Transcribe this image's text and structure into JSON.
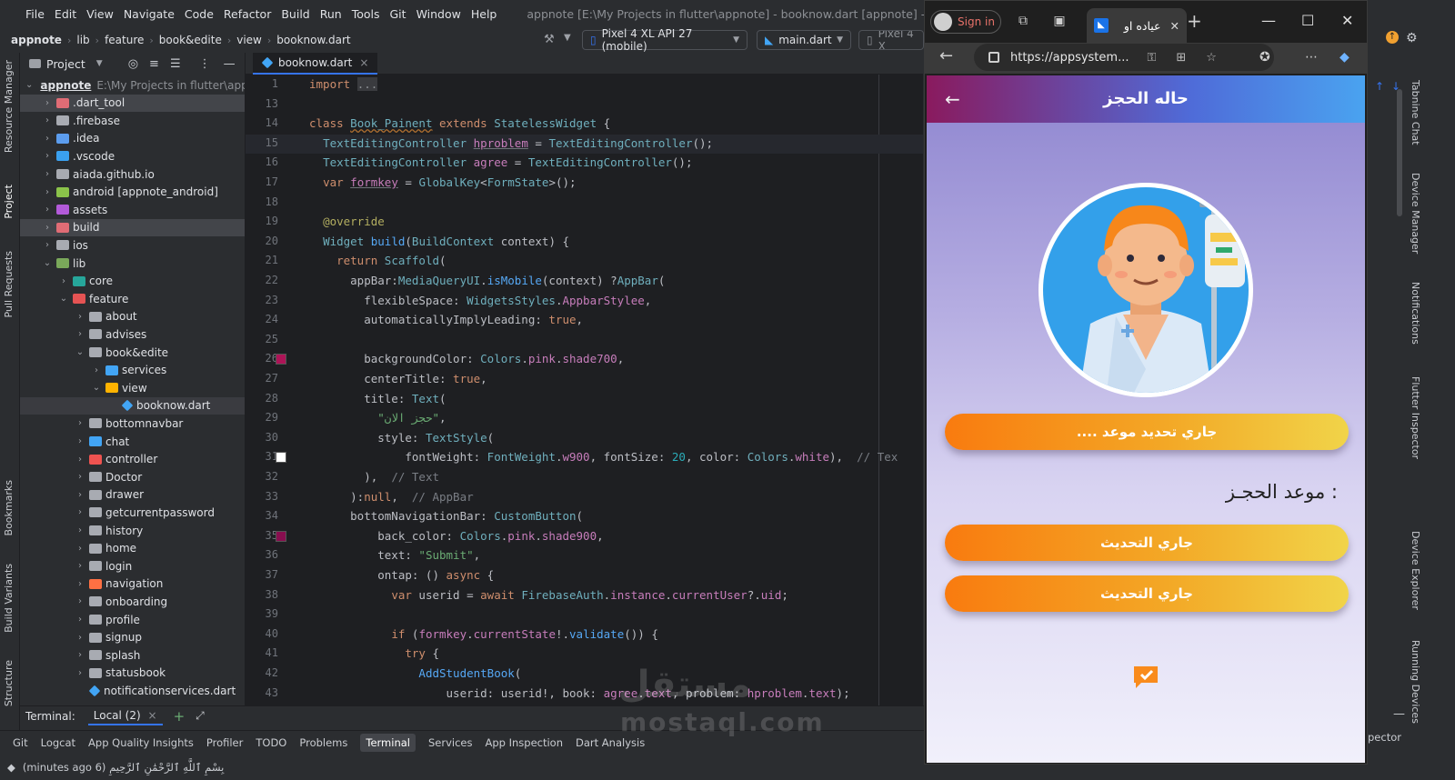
{
  "ide": {
    "menu": [
      "File",
      "Edit",
      "View",
      "Navigate",
      "Code",
      "Refactor",
      "Build",
      "Run",
      "Tools",
      "Git",
      "Window",
      "Help"
    ],
    "window_title": "appnote [E:\\My Projects in flutter\\appnote] - booknow.dart [appnote] - Administrator",
    "breadcrumbs": [
      "appnote",
      "lib",
      "feature",
      "book&edite",
      "view",
      "booknow.dart"
    ],
    "device": "Pixel 4 XL API 27 (mobile)",
    "run_config": "main.dart",
    "device2": "Pixel 4 X",
    "left_tabs": [
      "Resource Manager",
      "Project",
      "Pull Requests",
      "Bookmarks",
      "Build Variants",
      "Structure"
    ],
    "right_tabs": [
      "Tabnine Chat",
      "Device Manager",
      "Notifications",
      "Flutter Inspector",
      "Device Explorer",
      "Running Devices"
    ],
    "project_panel": {
      "title": "Project",
      "tree": [
        {
          "label": "appnote",
          "hint": "E:\\My Projects in flutter\\appno",
          "depth": 0,
          "open": true,
          "icon": "module",
          "bold": true
        },
        {
          "label": ".dart_tool",
          "depth": 1,
          "open": false,
          "icon": "folder-excluded",
          "selected": true
        },
        {
          "label": ".firebase",
          "depth": 1,
          "open": false,
          "icon": "folder"
        },
        {
          "label": ".idea",
          "depth": 1,
          "open": false,
          "icon": "folder-idea"
        },
        {
          "label": ".vscode",
          "depth": 1,
          "open": false,
          "icon": "folder-vscode"
        },
        {
          "label": "aiada.github.io",
          "depth": 1,
          "open": false,
          "icon": "folder"
        },
        {
          "label": "android [appnote_android]",
          "depth": 1,
          "open": false,
          "icon": "folder-android",
          "bold_part": "[appnote_android]"
        },
        {
          "label": "assets",
          "depth": 1,
          "open": false,
          "icon": "folder-assets"
        },
        {
          "label": "build",
          "depth": 1,
          "open": false,
          "icon": "folder-excluded",
          "selected": true
        },
        {
          "label": "ios",
          "depth": 1,
          "open": false,
          "icon": "folder"
        },
        {
          "label": "lib",
          "depth": 1,
          "open": true,
          "icon": "folder-source"
        },
        {
          "label": "core",
          "depth": 2,
          "open": false,
          "icon": "folder-core"
        },
        {
          "label": "feature",
          "depth": 2,
          "open": true,
          "icon": "folder-feature"
        },
        {
          "label": "about",
          "depth": 3,
          "open": false,
          "icon": "folder"
        },
        {
          "label": "advises",
          "depth": 3,
          "open": false,
          "icon": "folder"
        },
        {
          "label": "book&edite",
          "depth": 3,
          "open": true,
          "icon": "folder"
        },
        {
          "label": "services",
          "depth": 4,
          "open": false,
          "icon": "folder-services"
        },
        {
          "label": "view",
          "depth": 4,
          "open": true,
          "icon": "folder-view"
        },
        {
          "label": "booknow.dart",
          "depth": 5,
          "icon": "dart",
          "file": true,
          "selected2": true
        },
        {
          "label": "bottomnavbar",
          "depth": 3,
          "open": false,
          "icon": "folder"
        },
        {
          "label": "chat",
          "depth": 3,
          "open": false,
          "icon": "folder-chat"
        },
        {
          "label": "controller",
          "depth": 3,
          "open": false,
          "icon": "folder-controller"
        },
        {
          "label": "Doctor",
          "depth": 3,
          "open": false,
          "icon": "folder"
        },
        {
          "label": "drawer",
          "depth": 3,
          "open": false,
          "icon": "folder"
        },
        {
          "label": "getcurrentpassword",
          "depth": 3,
          "open": false,
          "icon": "folder"
        },
        {
          "label": "history",
          "depth": 3,
          "open": false,
          "icon": "folder"
        },
        {
          "label": "home",
          "depth": 3,
          "open": false,
          "icon": "folder-home"
        },
        {
          "label": "login",
          "depth": 3,
          "open": false,
          "icon": "folder"
        },
        {
          "label": "navigation",
          "depth": 3,
          "open": false,
          "icon": "folder-navigation"
        },
        {
          "label": "onboarding",
          "depth": 3,
          "open": false,
          "icon": "folder"
        },
        {
          "label": "profile",
          "depth": 3,
          "open": false,
          "icon": "folder"
        },
        {
          "label": "signup",
          "depth": 3,
          "open": false,
          "icon": "folder"
        },
        {
          "label": "splash",
          "depth": 3,
          "open": false,
          "icon": "folder"
        },
        {
          "label": "statusbook",
          "depth": 3,
          "open": false,
          "icon": "folder"
        },
        {
          "label": "notificationservices.dart",
          "depth": 3,
          "icon": "dart",
          "file": true
        }
      ]
    },
    "editor_tab": "booknow.dart",
    "code_lines": [
      {
        "n": "1",
        "html": "<span class='kw'>import</span> <span style='background:#3a3b3f;color:#8c8f94'>...</span>"
      },
      {
        "n": "13",
        "html": ""
      },
      {
        "n": "14",
        "html": "<span class='kw'>class</span> <span class='typ' style='text-decoration:underline wavy #b07030'>Book_Painent</span> <span class='kw'>extends</span> <span class='typ'>StatelessWidget</span> {"
      },
      {
        "n": "15",
        "html": "  <span class='typ'>TextEditingController</span> <span class='fld' style='text-decoration:underline #6f737a'>hproblem</span> = <span class='typ'>TextEditingController</span>();",
        "current": true
      },
      {
        "n": "16",
        "html": "  <span class='typ'>TextEditingController</span> <span class='fld'>agree</span> = <span class='typ'>TextEditingController</span>();"
      },
      {
        "n": "17",
        "html": "  <span class='kw'>var</span> <span class='fld' style='text-decoration:underline #6f737a'>formkey</span> = <span class='typ'>GlobalKey</span>&lt;<span class='typ'>FormState</span>&gt;();"
      },
      {
        "n": "18",
        "html": ""
      },
      {
        "n": "19",
        "html": "  <span class='ann'>@override</span>"
      },
      {
        "n": "20",
        "html": "  <span class='typ'>Widget</span> <span class='fn'>build</span>(<span class='typ'>BuildContext</span> context) {"
      },
      {
        "n": "21",
        "html": "    <span class='kw'>return</span> <span class='typ'>Scaffold</span>("
      },
      {
        "n": "22",
        "html": "      appBar:<span class='typ'>MediaQueryUI</span>.<span class='fn'>isMobile</span>(context) ?<span class='typ'>AppBar</span>("
      },
      {
        "n": "23",
        "html": "        flexibleSpace: <span class='typ'>WidgetsStyles</span>.<span class='fld'>AppbarStylee</span>,"
      },
      {
        "n": "24",
        "html": "        automaticallyImplyLeading: <span class='kw'>true</span>,"
      },
      {
        "n": "25",
        "html": ""
      },
      {
        "n": "26",
        "html": "        backgroundColor: <span class='typ'>Colors</span>.<span class='fld'>pink</span>.<span class='fld'>shade700</span>,",
        "swatch": "#ad1457"
      },
      {
        "n": "27",
        "html": "        centerTitle: <span class='kw'>true</span>,"
      },
      {
        "n": "28",
        "html": "        title: <span class='typ'>Text</span>("
      },
      {
        "n": "29",
        "html": "          <span class='str'>\"حجز الان\"</span>,"
      },
      {
        "n": "30",
        "html": "          style: <span class='typ'>TextStyle</span>("
      },
      {
        "n": "31",
        "html": "              fontWeight: <span class='typ'>FontWeight</span>.<span class='fld'>w900</span>, fontSize: <span class='num'>20</span>, color: <span class='typ'>Colors</span>.<span class='fld'>white</span>),  <span class='cm'>// Tex</span>",
        "swatch": "#ffffff"
      },
      {
        "n": "32",
        "html": "        ),  <span class='cm'>// Text</span>"
      },
      {
        "n": "33",
        "html": "      ):<span class='kw'>null</span>,  <span class='cm'>// AppBar</span>"
      },
      {
        "n": "34",
        "html": "      bottomNavigationBar: <span class='typ'>CustomButton</span>("
      },
      {
        "n": "35",
        "html": "          back_color: <span class='typ'>Colors</span>.<span class='fld'>pink</span>.<span class='fld'>shade900</span>,",
        "swatch": "#880e4f"
      },
      {
        "n": "36",
        "html": "          text: <span class='str'>\"Submit\"</span>,"
      },
      {
        "n": "37",
        "html": "          ontap: () <span class='kw'>async</span> {"
      },
      {
        "n": "38",
        "html": "            <span class='kw'>var</span> userid = <span class='kw'>await</span> <span class='typ'>FirebaseAuth</span>.<span class='fld'>instance</span>.<span class='fld'>currentUser</span>?.<span class='fld'>uid</span>;"
      },
      {
        "n": "39",
        "html": ""
      },
      {
        "n": "40",
        "html": "            <span class='kw'>if</span> (<span class='fld'>formkey</span>.<span class='fld'>currentState</span>!.<span class='fn'>validate</span>()) {"
      },
      {
        "n": "41",
        "html": "              <span class='kw'>try</span> {"
      },
      {
        "n": "42",
        "html": "                <span class='fn'>AddStudentBook</span>("
      },
      {
        "n": "43",
        "html": "                    userid: userid!, book: <span class='fld'>agree</span>.<span class='fld'>text</span>, problem: <span class='fld'>hproblem</span>.<span class='fld'>text</span>);"
      }
    ],
    "terminal": {
      "label": "Terminal:",
      "tab": "Local (2)"
    },
    "bottom_tools": [
      "Git",
      "Logcat",
      "App Quality Insights",
      "Profiler",
      "TODO",
      "Problems",
      "Terminal",
      "Services",
      "App Inspection",
      "Dart Analysis"
    ],
    "active_tool": "Terminal",
    "status_text": "(minutes ago 6) بِسْمِ ٱللَّهِ ٱلرَّحْمَٰنِ ٱلرَّحِيمِ",
    "right_edge_tool": "pector"
  },
  "browser": {
    "sign_in": "Sign in",
    "tab_title": "عياده او",
    "url": "https://appsystem...",
    "app": {
      "title": "حاله الحجز",
      "status_button": ".... جاري تحديد موعد",
      "date_label": "موعد الحجـز :",
      "update_button_1": "جاري التحديث",
      "update_button_2": "جاري التحديث"
    }
  },
  "watermark": {
    "ar": "مستقل",
    "en": "mostaql.com"
  },
  "colors": {
    "accent": "#3574f0",
    "orange": "#f97b0f",
    "yellow": "#f1d449",
    "appbar_pink": "#8a1a5e",
    "appbar_blue": "#4aa3f0"
  }
}
